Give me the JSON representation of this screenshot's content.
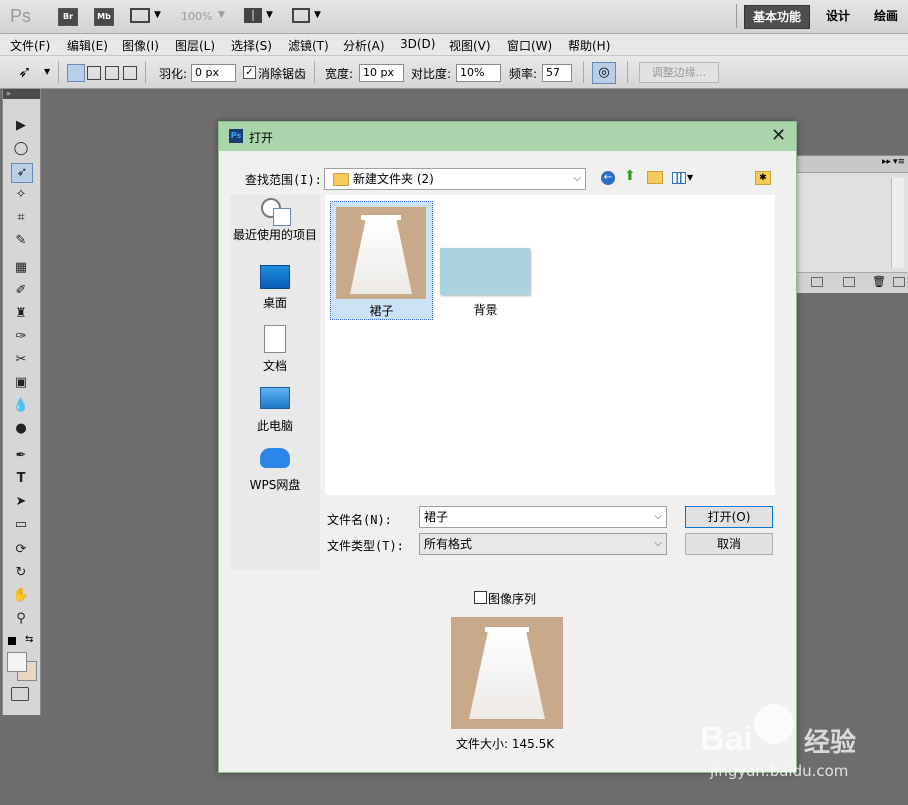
{
  "app": {
    "logo": "Ps",
    "bridge": "Br",
    "minibridge": "Mb",
    "zoom": "100%",
    "workspaces": [
      "基本功能",
      "设计",
      "绘画"
    ]
  },
  "menu": [
    "文件(F)",
    "编辑(E)",
    "图像(I)",
    "图层(L)",
    "选择(S)",
    "滤镜(T)",
    "分析(A)",
    "3D(D)",
    "视图(V)",
    "窗口(W)",
    "帮助(H)"
  ],
  "options": {
    "feather_label": "羽化:",
    "feather_value": "0 px",
    "antialias_label": "消除锯齿",
    "width_label": "宽度:",
    "width_value": "10 px",
    "contrast_label": "对比度:",
    "contrast_value": "10%",
    "frequency_label": "频率:",
    "frequency_value": "57",
    "refine_edge": "调整边缘..."
  },
  "dialog": {
    "title": "打开",
    "lookin_label": "查找范围(I):",
    "lookin_value": "新建文件夹 (2)",
    "places": [
      "最近使用的项目",
      "桌面",
      "文档",
      "此电脑",
      "WPS网盘"
    ],
    "files": [
      "裙子",
      "背景"
    ],
    "filename_label": "文件名(N):",
    "filename_value": "裙子",
    "filetype_label": "文件类型(T):",
    "filetype_value": "所有格式",
    "open_button": "打开(O)",
    "cancel_button": "取消",
    "sequence_label": "图像序列",
    "filesize": "文件大小: 145.5K"
  },
  "watermark": {
    "brand": "Bai",
    "brand2": "经验",
    "url": "jingyan.baidu.com"
  },
  "colors": {
    "dialog_title_bg": "#a9d5aa",
    "canvas_bg": "#6d6d6d",
    "bg_thumb": "#a8d3df"
  }
}
